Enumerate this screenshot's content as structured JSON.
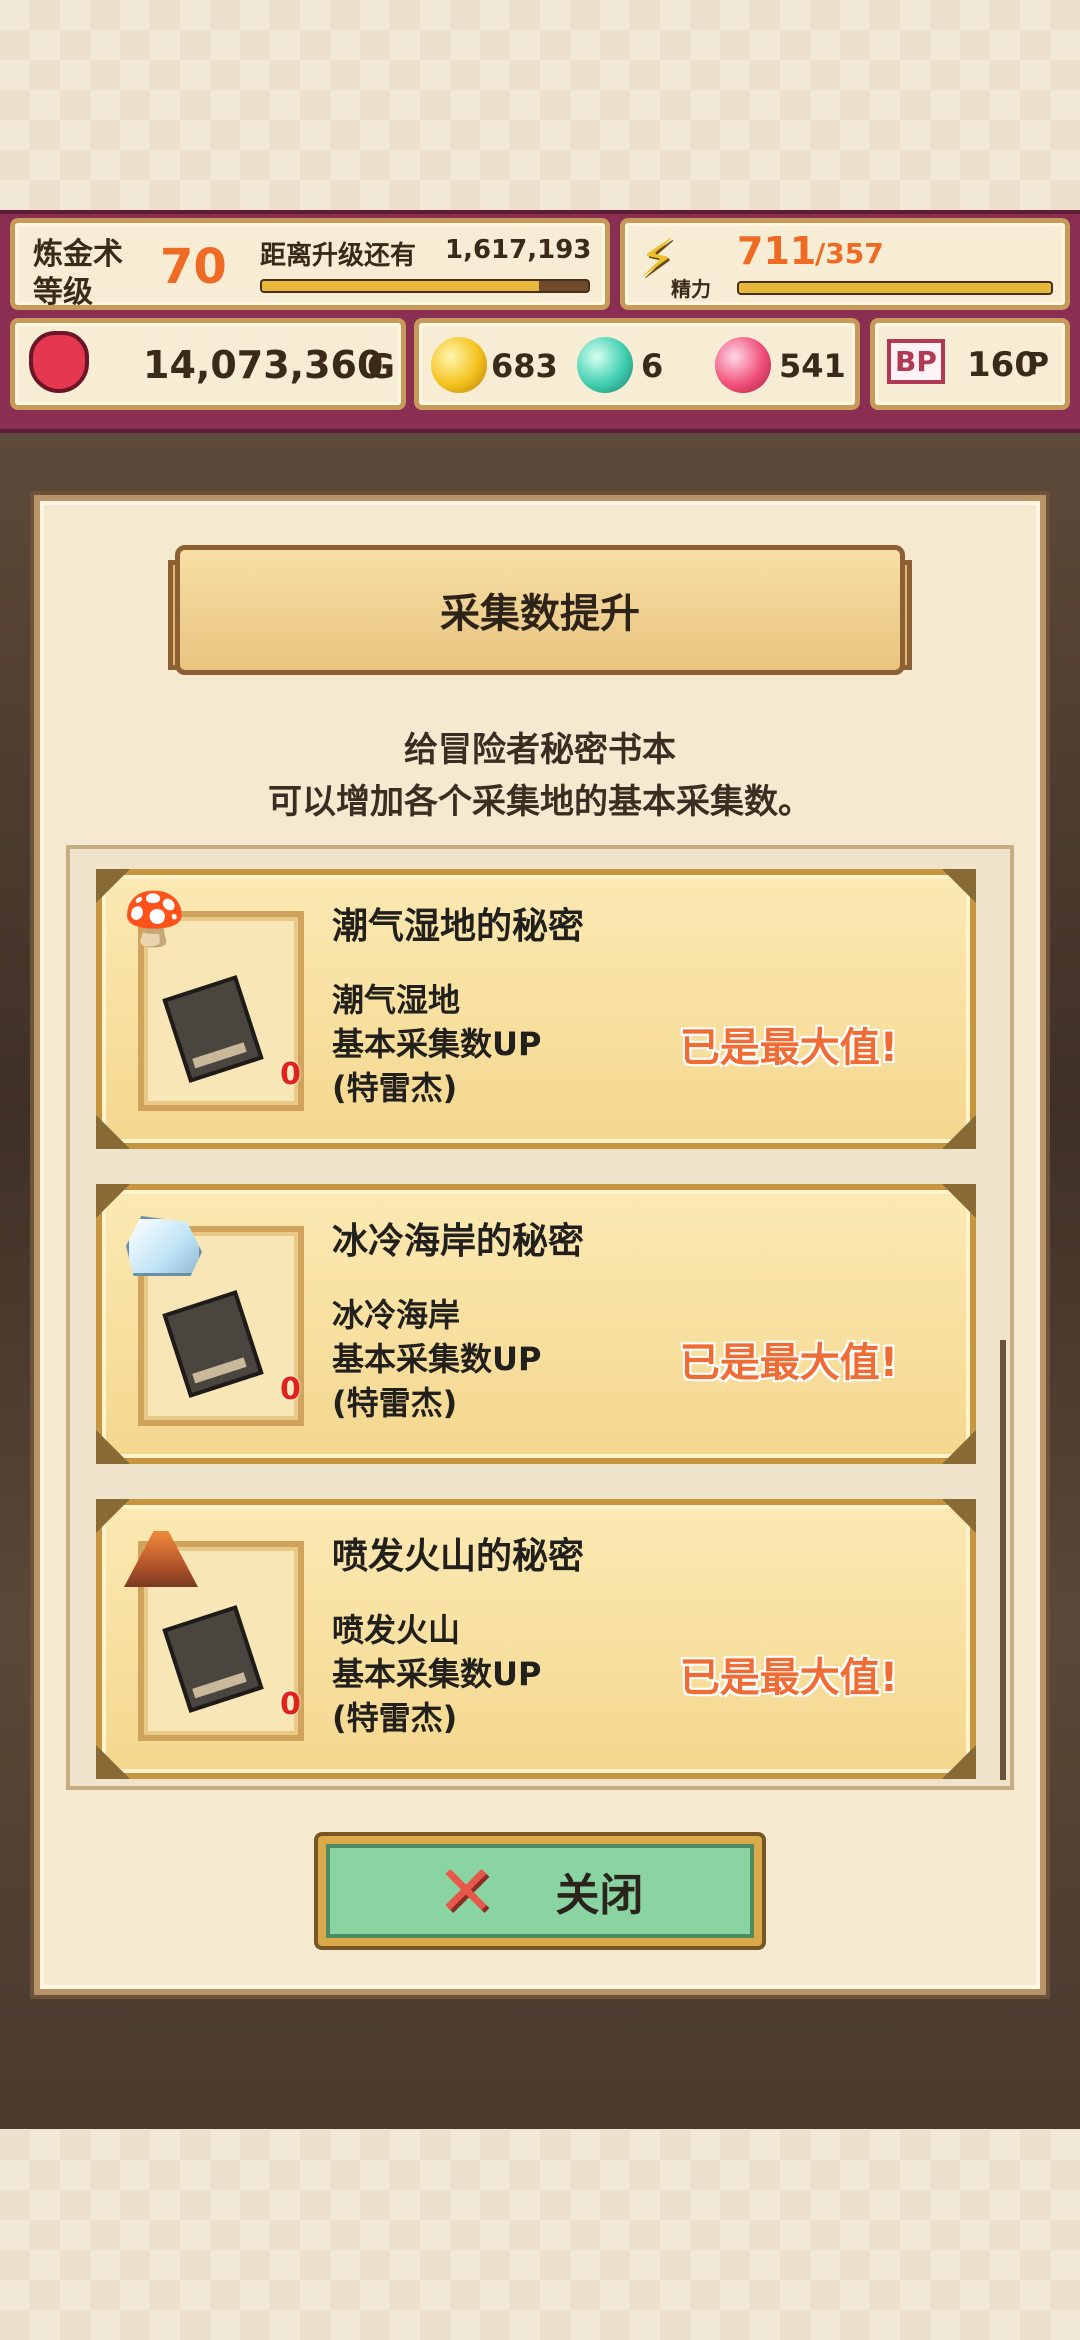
{
  "top_bar": {
    "alchemy_label_line1": "炼金术",
    "alchemy_label_line2": "等级",
    "alchemy_level": "70",
    "next_level_label": "距离升级还有",
    "next_level_value": "1,617,193",
    "level_progress": 0.85,
    "stamina_label": "精力",
    "stamina_current": "711",
    "stamina_max": "/357",
    "stamina_progress": 1.0,
    "gold": "14,073,360",
    "gold_unit": "G",
    "gem_yellow": "683",
    "gem_cyan": "6",
    "gem_pink": "541",
    "bp_icon": "BP",
    "bp_value": "160",
    "bp_unit": "P"
  },
  "dialog": {
    "title": "采集数提升",
    "desc_line1": "给冒险者秘密书本",
    "desc_line2": "可以增加各个采集地的基本采集数。",
    "items": [
      {
        "title": "潮气湿地的秘密",
        "area": "潮气湿地",
        "effect": "基本采集数UP",
        "for": "(特雷杰)",
        "count": "0",
        "status": "已是最大值!",
        "icon": "mushroom-icon"
      },
      {
        "title": "冰冷海岸的秘密",
        "area": "冰冷海岸",
        "effect": "基本采集数UP",
        "for": "(特雷杰)",
        "count": "0",
        "status": "已是最大值!",
        "icon": "ice-icon"
      },
      {
        "title": "喷发火山的秘密",
        "area": "喷发火山",
        "effect": "基本采集数UP",
        "for": "(特雷杰)",
        "count": "0",
        "status": "已是最大值!",
        "icon": "volcano-icon"
      }
    ],
    "close_label": "关闭"
  },
  "colors": {
    "top_bar": "#8a2f52",
    "accent_orange": "#ef6b25",
    "close_button": "#8ad4a2"
  }
}
